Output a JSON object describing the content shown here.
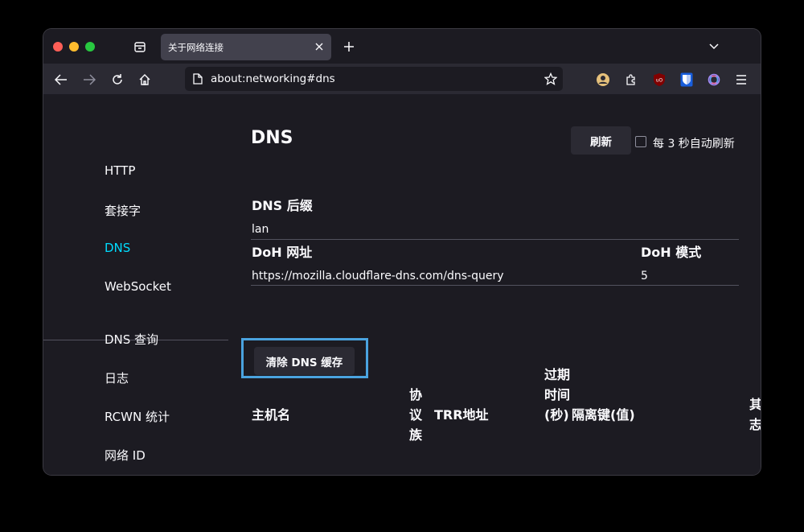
{
  "tab": {
    "title": "关于网络连接",
    "close_icon": "close-icon"
  },
  "url": {
    "text": "about:networking#dns"
  },
  "sidebar": {
    "items": [
      {
        "label": "HTTP"
      },
      {
        "label": "套接字"
      },
      {
        "label": "DNS",
        "active": true
      },
      {
        "label": "WebSocket"
      },
      {
        "label": "DNS 查询"
      },
      {
        "label": "日志"
      },
      {
        "label": "RCWN 统计"
      },
      {
        "label": "网络 ID"
      }
    ]
  },
  "main": {
    "title": "DNS",
    "refresh_label": "刷新",
    "auto_refresh_label": "每 3 秒自动刷新",
    "suffix_heading": "DNS 后缀",
    "suffix_value": "lan",
    "doh_url_heading": "DoH 网址",
    "doh_mode_heading": "DoH 模式",
    "doh_url_value": "https://mozilla.cloudflare-dns.com/dns-query",
    "doh_mode_value": "5",
    "clear_label": "清除 DNS 缓存",
    "table_headers": {
      "hostname": "主机名",
      "family": "协议族",
      "trr": "TRR地址",
      "expires": "过期时间(秒)",
      "isolation": "隔离键(值)",
      "other": "其志"
    }
  },
  "colors": {
    "accent": "#00ddff",
    "highlight": "#4aa3df",
    "background": "#1c1b22",
    "toolbar": "#2b2a33"
  }
}
